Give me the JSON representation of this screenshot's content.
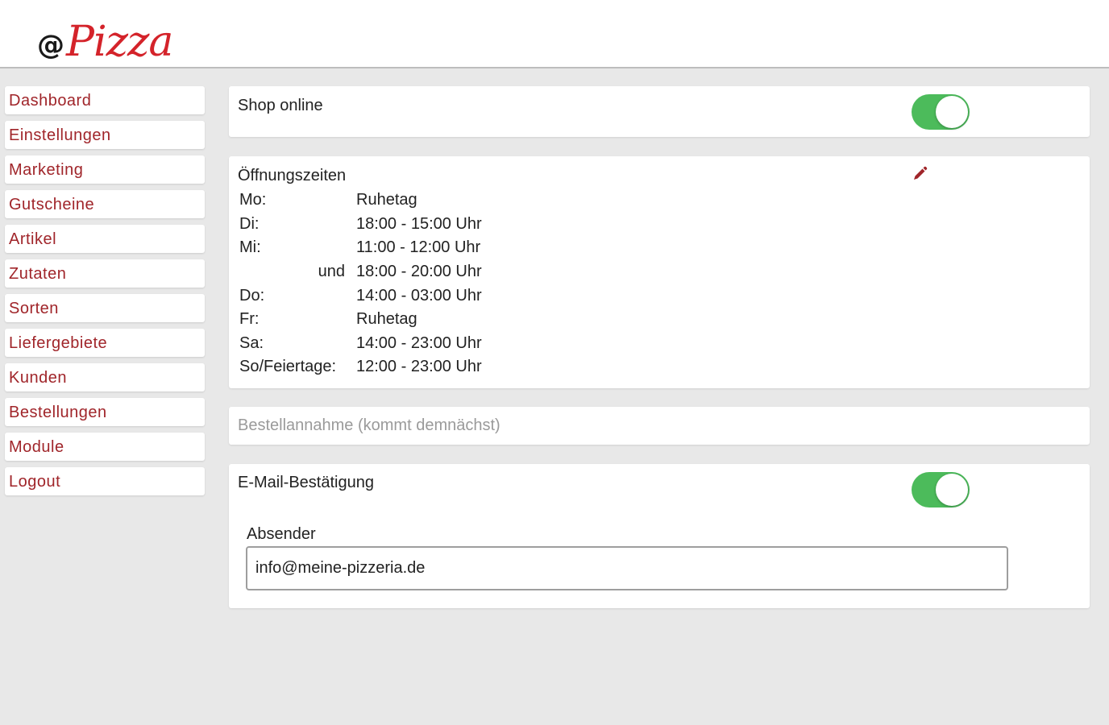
{
  "app": {
    "logo_prefix": "@",
    "logo_name": "Pizza"
  },
  "sidebar": {
    "items": [
      {
        "label": "Dashboard"
      },
      {
        "label": "Einstellungen"
      },
      {
        "label": "Marketing"
      },
      {
        "label": "Gutscheine"
      },
      {
        "label": "Artikel"
      },
      {
        "label": "Zutaten"
      },
      {
        "label": "Sorten"
      },
      {
        "label": "Liefergebiete"
      },
      {
        "label": "Kunden"
      },
      {
        "label": "Bestellungen"
      },
      {
        "label": "Module"
      },
      {
        "label": "Logout"
      }
    ]
  },
  "shop_online": {
    "label": "Shop online",
    "enabled": true
  },
  "opening_hours": {
    "title": "Öffnungszeiten",
    "edit_icon": "pencil-icon",
    "rows": [
      {
        "day": "Mo:",
        "time": "Ruhetag"
      },
      {
        "day": "Di:",
        "time": "18:00 - 15:00 Uhr"
      },
      {
        "day": "Mi:",
        "time": "11:00 - 12:00 Uhr"
      },
      {
        "day": "und",
        "time": "18:00 - 20:00 Uhr"
      },
      {
        "day": "Do:",
        "time": "14:00 - 03:00 Uhr"
      },
      {
        "day": "Fr:",
        "time": "Ruhetag"
      },
      {
        "day": "Sa:",
        "time": "14:00 - 23:00 Uhr"
      },
      {
        "day": "So/Feiertage:",
        "time": "12:00 - 23:00 Uhr"
      }
    ]
  },
  "order_acceptance": {
    "label": "Bestellannahme (kommt demnächst)"
  },
  "email_confirmation": {
    "label": "E-Mail-Bestätigung",
    "enabled": true,
    "sender_label": "Absender",
    "sender_value": "info@meine-pizzeria.de"
  },
  "colors": {
    "brand_red": "#d4232a",
    "nav_text": "#a0252a",
    "toggle_on": "#4cbb5b",
    "background": "#e8e8e8"
  }
}
